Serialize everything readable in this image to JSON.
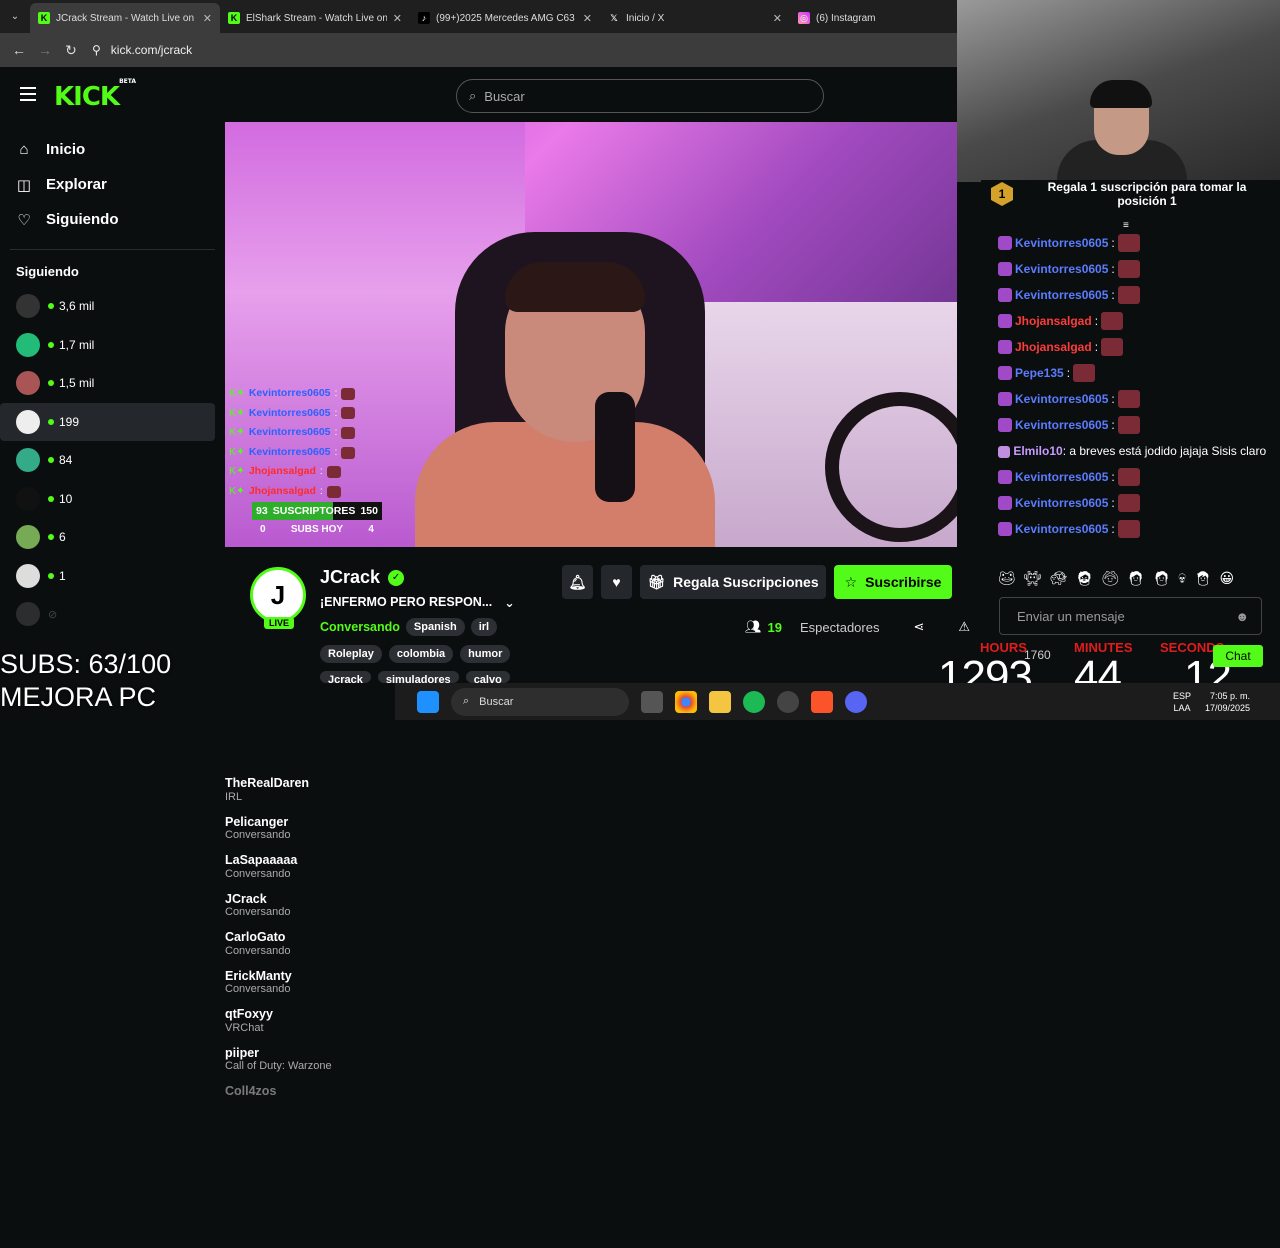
{
  "browser": {
    "tabs": [
      {
        "title": "JCrack Stream - Watch Live on K",
        "icon": "kick-icon",
        "active": true
      },
      {
        "title": "ElShark Stream - Watch Live on",
        "icon": "kick-icon",
        "active": false
      },
      {
        "title": "(99+)2025 Mercedes AMG C63",
        "icon": "tiktok-icon",
        "active": false
      },
      {
        "title": "Inicio / X",
        "icon": "x-icon",
        "active": false
      },
      {
        "title": "(6) Instagram",
        "icon": "instagram-icon",
        "active": false
      }
    ],
    "url": "kick.com/jcrack"
  },
  "header": {
    "logo": "KICK",
    "logo_badge": "BETA",
    "search_placeholder": "Buscar"
  },
  "sidebar": {
    "nav": [
      {
        "label": "Inicio",
        "icon": "home-icon"
      },
      {
        "label": "Explorar",
        "icon": "compass-icon"
      },
      {
        "label": "Siguiendo",
        "icon": "heart-icon"
      }
    ],
    "following_title": "Siguiendo",
    "channels": [
      {
        "name": "TheRealDaren",
        "category": "IRL",
        "viewers": "3,6 mil"
      },
      {
        "name": "Pelicanger",
        "category": "Conversando",
        "viewers": "1,7 mil"
      },
      {
        "name": "LaSapaaaaa",
        "category": "Conversando",
        "viewers": "1,5 mil"
      },
      {
        "name": "JCrack",
        "category": "Conversando",
        "viewers": "199"
      },
      {
        "name": "CarloGato",
        "category": "Conversando",
        "viewers": "84"
      },
      {
        "name": "ErickManty",
        "category": "Conversando",
        "viewers": "10"
      },
      {
        "name": "qtFoxyy",
        "category": "VRChat",
        "viewers": "6"
      },
      {
        "name": "piiper",
        "category": "Call of Duty: Warzone",
        "viewers": "1"
      },
      {
        "name": "Coll4zos",
        "category": "",
        "viewers": ""
      }
    ]
  },
  "player_overlay": {
    "chat": [
      {
        "user": "Kevintorres0605",
        "red": false
      },
      {
        "user": "Kevintorres0605",
        "red": false
      },
      {
        "user": "Kevintorres0605",
        "red": false
      },
      {
        "user": "Kevintorres0605",
        "red": false
      },
      {
        "user": "Jhojansalgad",
        "red": true
      },
      {
        "user": "Jhojansalgad",
        "red": true
      }
    ],
    "subs_goal": {
      "current": "93",
      "label": "SUSCRIPTORES",
      "target": "150",
      "progress": 0.62
    },
    "subs_today": {
      "left": "0",
      "label": "SUBS HOY",
      "right": "4"
    }
  },
  "channel": {
    "name": "JCrack",
    "live_badge": "LIVE",
    "title": "¡ENFERMO PERO RESPON...",
    "category": "Conversando",
    "language": "Spanish",
    "tag_irl": "irl",
    "tags": [
      "Roleplay",
      "colombia",
      "humor"
    ],
    "tags_row2": [
      "Jcrack",
      "simuladores",
      "calvo"
    ],
    "gift_button": "Regala Suscripciones",
    "subscribe_button": "Suscribirse",
    "viewers": "19",
    "viewers_label": "Espectadores"
  },
  "chat": {
    "pinned_rank": "1",
    "pinned_text": "Regala 1 suscripción para tomar la posición 1",
    "messages": [
      {
        "user": "Kevintorres0605",
        "color": "#5b7cff",
        "text": ""
      },
      {
        "user": "Kevintorres0605",
        "color": "#5b7cff",
        "text": ""
      },
      {
        "user": "Kevintorres0605",
        "color": "#5b7cff",
        "text": ""
      },
      {
        "user": "Jhojansalgad",
        "color": "#ff3b3b",
        "text": ""
      },
      {
        "user": "Jhojansalgad",
        "color": "#ff3b3b",
        "text": ""
      },
      {
        "user": "Pepe135",
        "color": "#5b7cff",
        "text": ""
      },
      {
        "user": "Kevintorres0605",
        "color": "#5b7cff",
        "text": ""
      },
      {
        "user": "Kevintorres0605",
        "color": "#5b7cff",
        "text": ""
      },
      {
        "user": "Elmilo10",
        "color": "#c89bff",
        "text": "a breves está jodido jajaja Sisis claro"
      },
      {
        "user": "Kevintorres0605",
        "color": "#5b7cff",
        "text": ""
      },
      {
        "user": "Kevintorres0605",
        "color": "#5b7cff",
        "text": ""
      },
      {
        "user": "Kevintorres0605",
        "color": "#5b7cff",
        "text": ""
      }
    ],
    "input_placeholder": "Enviar un mensaje",
    "chat_button": "Chat"
  },
  "stream_overlays": {
    "subs_text": "SUBS: 63/100",
    "mejora_text": "MEJORA PC",
    "timer": {
      "hours_label": "HOURS",
      "hours": "1293",
      "minutes_label": "MINUTES",
      "minutes": "44",
      "seconds_label": "SECONDS",
      "seconds": "12",
      "small_count": "1760"
    }
  },
  "taskbar": {
    "search": "Buscar",
    "lang": "ESP",
    "region": "LAA",
    "time": "7:05 p. m.",
    "date": "17/09/2025"
  },
  "colors": {
    "accent": "#53fc18",
    "bg": "#0b0e0f"
  }
}
